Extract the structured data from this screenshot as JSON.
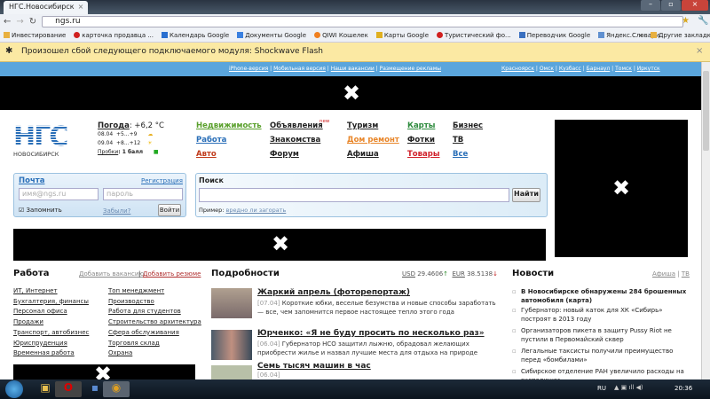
{
  "browser": {
    "tab_title": "НГС.Новосибирск",
    "url": "ngs.ru",
    "bookmarks": [
      "Инвестирование",
      "карточка продавца ...",
      "Календарь Google",
      "Документы Google",
      "QIWI Кошелек",
      "Карты Google",
      "Туристический фо...",
      "Переводчик Google",
      "Яндекс.Словари"
    ],
    "bookmarks_more": "»",
    "other_bookmarks": "Другие закладки",
    "infobar": "Произошел сбой следующего подключаемого модуля: Shockwave Flash"
  },
  "topnav": {
    "left": [
      "iPhone-версия",
      "Мобильная версия",
      "Наши вакансии",
      "Размещение рекламы"
    ],
    "cities": [
      "Красноярск",
      "Омск",
      "Кузбасс",
      "Барнаул",
      "Томск",
      "Иркутск"
    ]
  },
  "logo": {
    "title": "НГС",
    "city": "НОВОСИБИРСК"
  },
  "weather": {
    "label": "Погода",
    "current": ": +6,2 °C",
    "days": [
      {
        "date": "08.04",
        "range": "+5...+9"
      },
      {
        "date": "09.04",
        "range": "+8...+12"
      }
    ],
    "traffic_label": "Пробки",
    "traffic_value": ": 1 балл"
  },
  "links": [
    {
      "label": "Недвижимость",
      "color": "#5aa02c"
    },
    {
      "label": "Объявления",
      "color": "#222",
      "badge": "new"
    },
    {
      "label": "Туризм",
      "color": "#222"
    },
    {
      "label": "Карты",
      "color": "#2c8a3c"
    },
    {
      "label": "Бизнес",
      "color": "#222"
    },
    {
      "label": "Работа",
      "color": "#2a6fb8"
    },
    {
      "label": "Знакомства",
      "color": "#222"
    },
    {
      "label": "Дом ремонт",
      "color": "#e8862a"
    },
    {
      "label": "Фотки",
      "color": "#222"
    },
    {
      "label": "ТВ",
      "color": "#222"
    },
    {
      "label": "Авто",
      "color": "#c03a1a"
    },
    {
      "label": "Форум",
      "color": "#222"
    },
    {
      "label": "Афиша",
      "color": "#222"
    },
    {
      "label": "Товары",
      "color": "#d0202a"
    },
    {
      "label": "Все",
      "color": "#2a6fb8"
    }
  ],
  "mail": {
    "title": "Почта",
    "register": "Регистрация",
    "login_placeholder": "имя@ngs.ru",
    "password_placeholder": "пароль",
    "remember": "Запомнить",
    "forgot": "Забыли?",
    "submit": "Войти"
  },
  "search": {
    "title": "Поиск",
    "button": "Найти",
    "example_label": "Пример:",
    "example": "вредно ли загорать"
  },
  "jobs": {
    "title": "Работа",
    "add_vacancy": "Добавить вакансию",
    "sep": "|",
    "add_resume": "Добавить резюме",
    "col1": [
      "ИТ, Интернет",
      "Бухгалтерия, финансы",
      "Персонал офиса",
      "Продажи",
      "Транспорт, автобизнес",
      "Юриспруденция",
      "Временная работа"
    ],
    "col2": [
      "Топ менеджмент",
      "Производство",
      "Работа для студентов",
      "Строительство архитектура",
      "Сфера обслуживания",
      "Торговля склад",
      "Охрана"
    ]
  },
  "details": {
    "title": "Подробности",
    "usd_label": "USD",
    "usd": "29.4606",
    "eur_label": "EUR",
    "eur": "38.5138",
    "articles": [
      {
        "title": "Жаркий апрель (фоторепортаж)",
        "date": "[07.04]",
        "text": "Короткие юбки, веселые безумства и новые способы заработать — все, чем запомнится первое настоящее тепло этого года"
      },
      {
        "title": "Юрченко: «Я не буду просить по несколько раз»",
        "date": "[06.04]",
        "text": "Губернатор НСО защитил лыжню, обрадовал желающих приобрести жилье и назвал лучшие места для отдыха на природе"
      },
      {
        "title": "Семь тысяч машин в час",
        "date": "[06.04]",
        "text": ""
      }
    ]
  },
  "news": {
    "title": "Новости",
    "afisha": "Афиша",
    "sep": "|",
    "tv": "ТВ",
    "items": [
      {
        "text": "В Новосибирске обнаружены 284 брошенных автомобиля (карта)",
        "bold": true
      },
      {
        "text": "Губернатор: новый каток для ХК «Сибирь» построят в 2013 году"
      },
      {
        "text": "Организаторов пикета в защиту Pussy Riot не пустили в Первомайский сквер"
      },
      {
        "text": "Легальные таксисты получили преимущество перед «бомбилами»"
      },
      {
        "text": "Сибирское отделение РАН увеличило расходы на экспедиции"
      }
    ]
  },
  "taskbar": {
    "lang": "RU",
    "time": "20:36"
  }
}
